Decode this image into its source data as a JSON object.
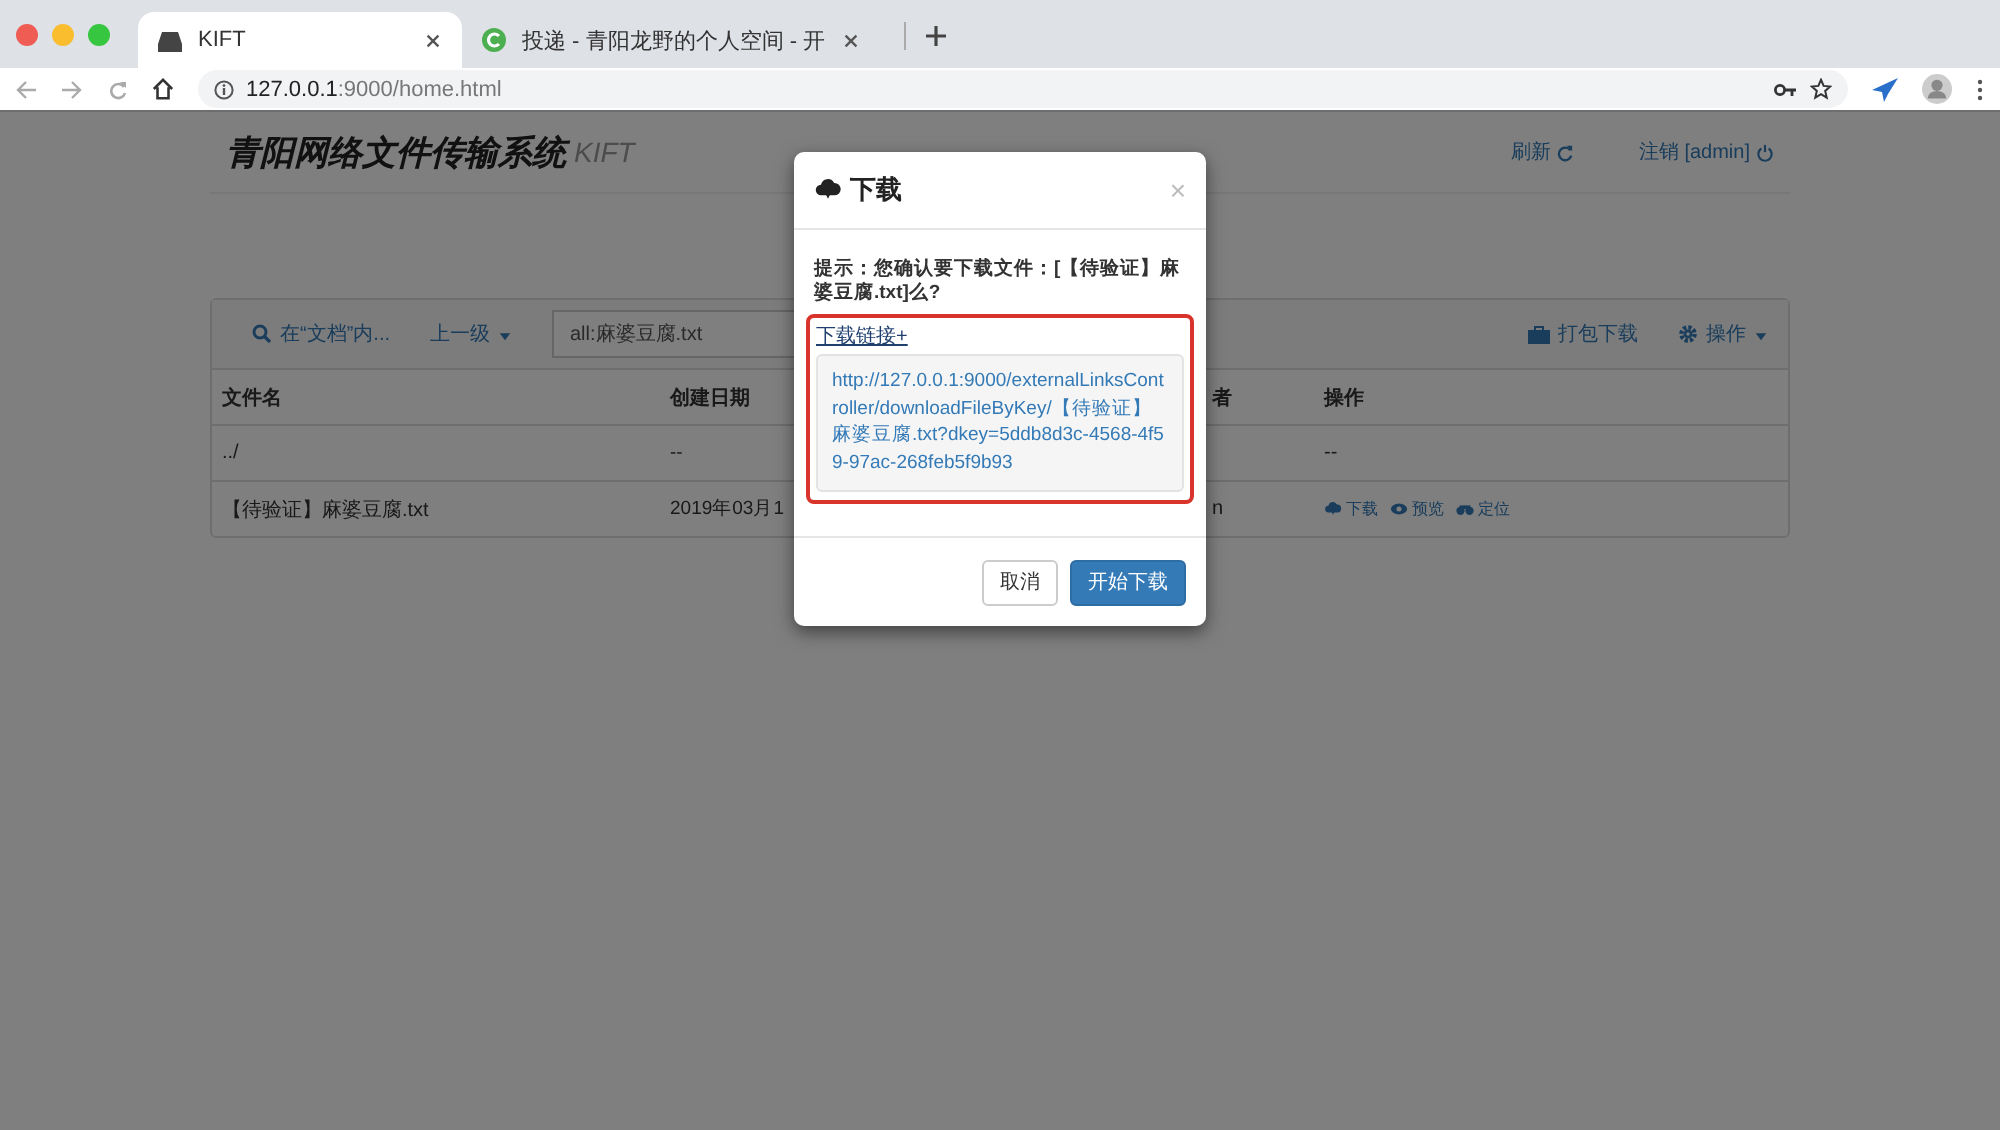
{
  "browser": {
    "tabs": [
      {
        "title": "KIFT",
        "selected": true
      },
      {
        "title": "投递 - 青阳龙野的个人空间 - 开",
        "selected": false
      }
    ],
    "address": {
      "host": "127.0.0.1",
      "path": ":9000/home.html"
    }
  },
  "header": {
    "title": "青阳网络文件传输系统",
    "subtitle": "KIFT",
    "refresh": "刷新",
    "logout": "注销 [admin]"
  },
  "toolbar": {
    "search": "在“文档”内...",
    "parent": "上一级",
    "path": "all:麻婆豆腐.txt",
    "pack": "打包下载",
    "actions": "操作"
  },
  "table": {
    "columns": [
      "文件名",
      "创建日期",
      "者",
      "操作"
    ],
    "rows": [
      {
        "cells": [
          "../",
          "--",
          "",
          "--"
        ],
        "actions": []
      },
      {
        "cells": [
          "【待验证】麻婆豆腐.txt",
          "2019年03月1",
          "n",
          ""
        ],
        "actions": [
          "下载",
          "预览",
          "定位"
        ]
      }
    ]
  },
  "modal": {
    "title": "下载",
    "close": "×",
    "message": "提示：您确认要下载文件：[【待验证】麻婆豆腐.txt]么?",
    "link_label": "下载链接+",
    "url": "http://127.0.0.1:9000/externalLinksController/downloadFileByKey/【待验证】麻婆豆腐.txt?dkey=5ddb8d3c-4568-4f59-97ac-268feb5f9b93",
    "buttons": [
      {
        "label": "取消",
        "kind": "default"
      },
      {
        "label": "开始下载",
        "kind": "primary"
      }
    ]
  }
}
